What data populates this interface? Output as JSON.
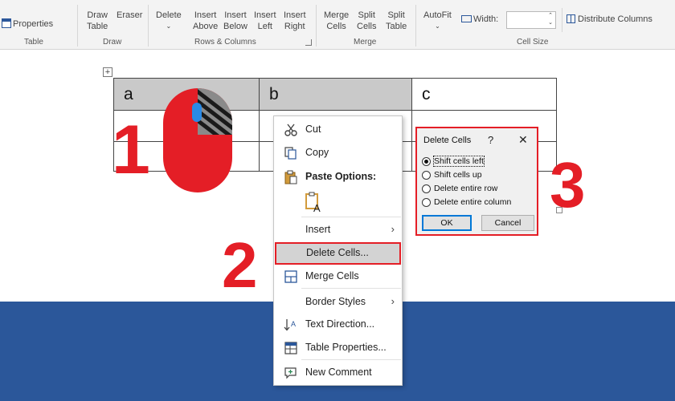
{
  "ribbon": {
    "properties": "Properties",
    "draw_table": [
      "Draw",
      "Table"
    ],
    "eraser": "Eraser",
    "delete": "Delete",
    "insert_above": [
      "Insert",
      "Above"
    ],
    "insert_below": [
      "Insert",
      "Below"
    ],
    "insert_left": [
      "Insert",
      "Left"
    ],
    "insert_right": [
      "Insert",
      "Right"
    ],
    "merge_cells": [
      "Merge",
      "Cells"
    ],
    "split_cells": [
      "Split",
      "Cells"
    ],
    "split_table": [
      "Split",
      "Table"
    ],
    "autofit": "AutoFit",
    "width_label": "Width:",
    "width_value": "",
    "distribute_columns": "Distribute Columns",
    "groups": {
      "table": "Table",
      "draw": "Draw",
      "rows_columns": "Rows & Columns",
      "merge": "Merge",
      "cell_size": "Cell Size"
    }
  },
  "table": {
    "header": [
      "a",
      "b",
      "c"
    ],
    "rows": 3
  },
  "steps": [
    "1",
    "2",
    "3"
  ],
  "context_menu": {
    "cut": "Cut",
    "copy": "Copy",
    "paste_options": "Paste Options:",
    "insert": "Insert",
    "delete_cells": "Delete Cells...",
    "merge_cells": "Merge Cells",
    "border_styles": "Border Styles",
    "text_direction": "Text Direction...",
    "table_properties": "Table Properties...",
    "new_comment": "New Comment"
  },
  "dialog": {
    "title": "Delete Cells",
    "help": "?",
    "close": "✕",
    "options": [
      {
        "label": "Shift cells left",
        "selected": true
      },
      {
        "label": "Shift cells up",
        "selected": false
      },
      {
        "label": "Delete entire row",
        "selected": false
      },
      {
        "label": "Delete entire column",
        "selected": false
      }
    ],
    "ok": "OK",
    "cancel": "Cancel"
  },
  "colors": {
    "accent_red": "#e41e26",
    "word_blue": "#2b579a",
    "mouse_blue": "#2a8ae6"
  }
}
